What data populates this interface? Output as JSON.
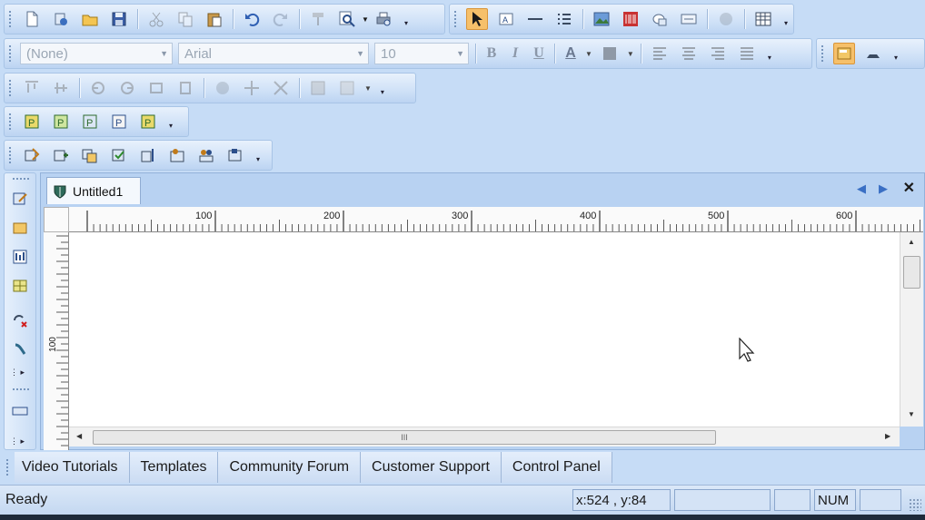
{
  "toolbar_format": {
    "style_value": "(None)",
    "font_value": "Arial",
    "size_value": "10",
    "bold_label": "B",
    "italic_label": "I",
    "underline_label": "U",
    "font_color_label": "A"
  },
  "document": {
    "tab_title": "Untitled1",
    "ruler_h_labels": [
      "100",
      "200",
      "300",
      "400",
      "500",
      "600"
    ],
    "ruler_v_label": "100",
    "scroll_grip": "III"
  },
  "link_tabs": [
    "Video Tutorials",
    "Templates",
    "Community Forum",
    "Customer Support",
    "Control Panel"
  ],
  "status": {
    "text": "Ready",
    "coords": "x:524 , y:84",
    "num": "NUM"
  },
  "icons": [
    "new-icon",
    "open-script-icon",
    "open-folder-icon",
    "save-icon",
    "cut-icon",
    "copy-icon",
    "paste-icon",
    "undo-icon",
    "redo-icon",
    "format-painter-icon",
    "zoom-icon",
    "print-preview-icon",
    "pointer-icon",
    "text-box-icon",
    "line-icon",
    "list-icon",
    "image-icon",
    "barcode-icon",
    "shape-icon",
    "label-icon",
    "globe-icon",
    "table-icon",
    "properties-icon",
    "layer-icon"
  ],
  "colors": {
    "app_background": "#c6dcf6",
    "active_tool": "#f6c06a",
    "nav_arrow": "#3a6fc4"
  }
}
